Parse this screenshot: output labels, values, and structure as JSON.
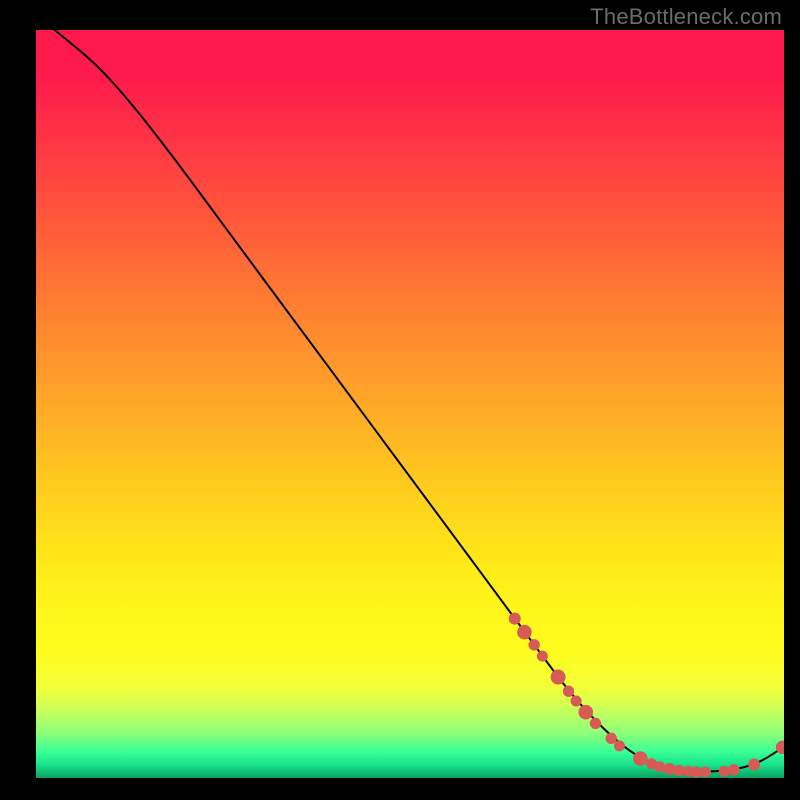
{
  "watermark": "TheBottleneck.com",
  "chart_data": {
    "type": "line",
    "title": "",
    "xlabel": "",
    "ylabel": "",
    "xlim": [
      0,
      100
    ],
    "ylim": [
      0,
      100
    ],
    "curve": [
      {
        "x": 2.5,
        "y": 100
      },
      {
        "x": 8.0,
        "y": 95.5
      },
      {
        "x": 12.5,
        "y": 90.5
      },
      {
        "x": 18.0,
        "y": 83.5
      },
      {
        "x": 25.0,
        "y": 74.0
      },
      {
        "x": 35.0,
        "y": 60.5
      },
      {
        "x": 45.0,
        "y": 47.0
      },
      {
        "x": 55.0,
        "y": 33.5
      },
      {
        "x": 65.0,
        "y": 20.0
      },
      {
        "x": 72.0,
        "y": 10.5
      },
      {
        "x": 78.0,
        "y": 4.5
      },
      {
        "x": 82.0,
        "y": 2.0
      },
      {
        "x": 86.0,
        "y": 1.0
      },
      {
        "x": 90.0,
        "y": 0.8
      },
      {
        "x": 94.0,
        "y": 1.2
      },
      {
        "x": 97.0,
        "y": 2.2
      },
      {
        "x": 100.0,
        "y": 4.2
      }
    ],
    "points": [
      {
        "x": 64.0,
        "y": 21.3,
        "r": 5.5
      },
      {
        "x": 65.3,
        "y": 19.5,
        "r": 6.8
      },
      {
        "x": 66.6,
        "y": 17.8,
        "r": 5.2
      },
      {
        "x": 67.7,
        "y": 16.3,
        "r": 5.0
      },
      {
        "x": 69.8,
        "y": 13.5,
        "r": 7.0
      },
      {
        "x": 71.2,
        "y": 11.6,
        "r": 5.2
      },
      {
        "x": 72.2,
        "y": 10.3,
        "r": 5.0
      },
      {
        "x": 73.5,
        "y": 8.8,
        "r": 6.8
      },
      {
        "x": 74.8,
        "y": 7.3,
        "r": 5.2
      },
      {
        "x": 76.9,
        "y": 5.3,
        "r": 5.2
      },
      {
        "x": 78.0,
        "y": 4.3,
        "r": 5.0
      },
      {
        "x": 80.8,
        "y": 2.6,
        "r": 6.8
      },
      {
        "x": 82.3,
        "y": 1.9,
        "r": 5.0
      },
      {
        "x": 83.4,
        "y": 1.5,
        "r": 5.0
      },
      {
        "x": 84.7,
        "y": 1.2,
        "r": 5.5
      },
      {
        "x": 86.0,
        "y": 1.0,
        "r": 5.2
      },
      {
        "x": 87.2,
        "y": 0.9,
        "r": 5.0
      },
      {
        "x": 88.3,
        "y": 0.8,
        "r": 5.2
      },
      {
        "x": 89.5,
        "y": 0.8,
        "r": 5.0
      },
      {
        "x": 92.0,
        "y": 0.9,
        "r": 5.0
      },
      {
        "x": 93.3,
        "y": 1.1,
        "r": 5.2
      },
      {
        "x": 96.0,
        "y": 1.8,
        "r": 5.5
      },
      {
        "x": 99.8,
        "y": 4.1,
        "r": 6.2
      }
    ]
  }
}
